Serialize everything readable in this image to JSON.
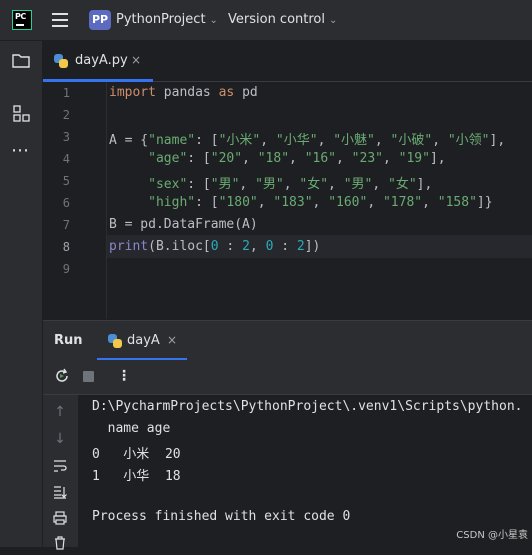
{
  "titlebar": {
    "logo_text": "PC",
    "project_badge": "PP",
    "project_name": "PythonProject",
    "version_control": "Version control"
  },
  "editor_tab": {
    "label": "dayA.py",
    "close": "×"
  },
  "editor": {
    "line_numbers": [
      "1",
      "2",
      "3",
      "4",
      "5",
      "6",
      "7",
      "8",
      "9"
    ],
    "current_line": "8"
  },
  "run_panel": {
    "title": "Run",
    "tab_label": "dayA",
    "tab_close": "×",
    "console": [
      "D:\\PycharmProjects\\PythonProject\\.venv1\\Scripts\\python.",
      "  name age",
      "0   小米  20",
      "1   小华  18",
      "",
      "Process finished with exit code 0"
    ]
  },
  "watermark": "CSDN @小星袁",
  "colors": {
    "accent": "#3574f0",
    "keyword": "#cf8e6d",
    "string": "#6aab73",
    "number": "#2aacb8"
  }
}
